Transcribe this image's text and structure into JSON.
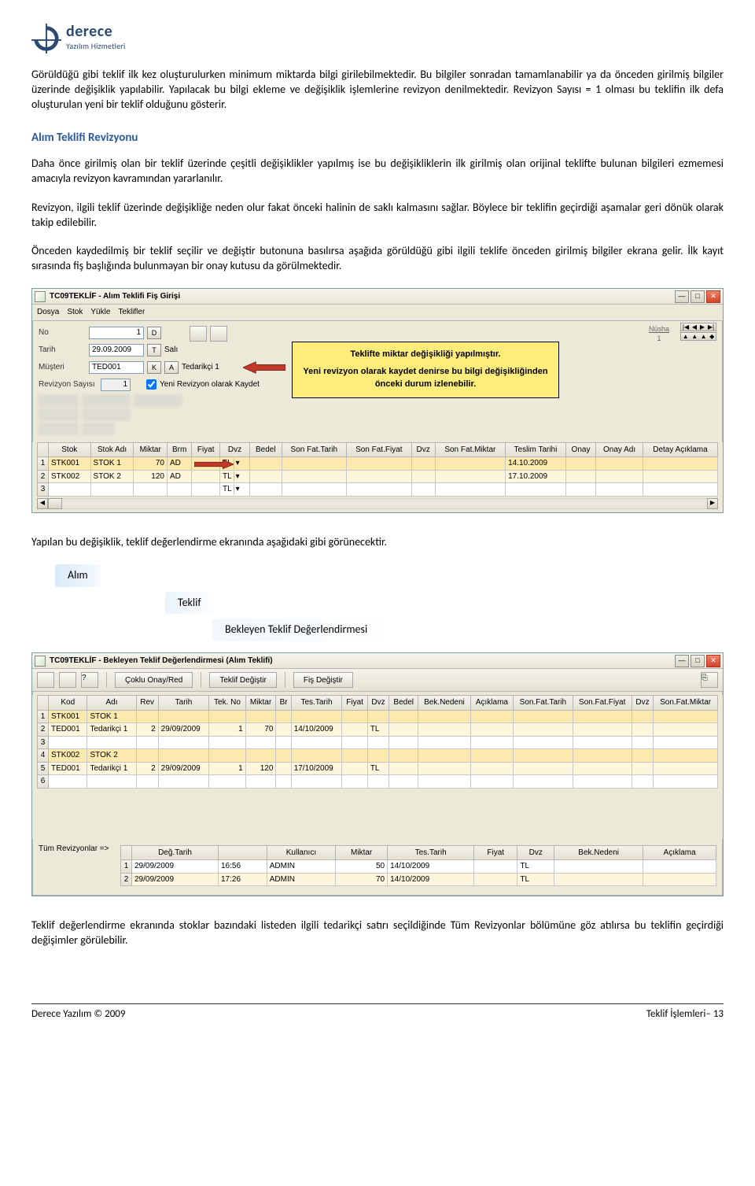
{
  "logo": {
    "name": "derece",
    "sub": "Yazılım Hizmetleri"
  },
  "para1": "Görüldüğü gibi teklif ilk kez oluşturulurken minimum miktarda bilgi girilebilmektedir. Bu bilgiler sonradan tamamlanabilir ya da önceden girilmiş bilgiler üzerinde değişiklik yapılabilir. Yapılacak bu bilgi ekleme ve değişiklik işlemlerine revizyon denilmektedir. Revizyon Sayısı = 1 olması bu teklifin ilk defa oluşturulan yeni bir teklif olduğunu gösterir.",
  "section1_title": "Alım Teklifi Revizyonu",
  "para2": "Daha önce girilmiş olan bir teklif üzerinde çeşitli değişiklikler yapılmış ise bu değişikliklerin ilk girilmiş olan orijinal teklifte bulunan bilgileri ezmemesi amacıyla revizyon kavramından yararlanılır.",
  "para3": "Revizyon, ilgili teklif üzerinde değişikliğe neden olur fakat önceki halinin de saklı kalmasını sağlar. Böylece bir teklifin geçirdiği aşamalar geri dönük olarak takip edilebilir.",
  "para4": "Önceden kaydedilmiş bir teklif seçilir ve değiştir butonuna basılırsa aşağıda görüldüğü gibi ilgili teklife önceden girilmiş bilgiler ekrana gelir. İlk kayıt sırasında fiş başlığında bulunmayan bir onay kutusu da görülmektedir.",
  "win1": {
    "title": "TC09TEKLİF - Alım Teklifi Fiş Girişi",
    "menu": [
      "Dosya",
      "Stok",
      "Yükle",
      "Teklifler"
    ],
    "labels": {
      "no": "No",
      "tarih": "Tarih",
      "musteri": "Müşteri",
      "revsayisi": "Revizyon Sayısı",
      "day": "Salı",
      "checkbox": "Yeni Revizyon olarak Kaydet",
      "nusha": "Nüsha",
      "nusha_val": "1"
    },
    "fields": {
      "no": "1",
      "tarih": "29.09.2009",
      "musteri": "TED001",
      "musteri_ad": "Tedarikçi 1",
      "revsayisi": "1"
    },
    "buttons": {
      "d": "D",
      "t": "T",
      "k": "K",
      "a": "A"
    },
    "callout": {
      "line1": "Teklifte miktar değişikliği yapılmıştır.",
      "line2": "Yeni revizyon olarak kaydet denirse bu bilgi değişikliğinden önceki durum izlenebilir."
    },
    "headers": [
      "",
      "Stok",
      "Stok Adı",
      "Miktar",
      "Brm",
      "Fiyat",
      "Dvz",
      "Bedel",
      "Son Fat.Tarih",
      "Son Fat.Fiyat",
      "Dvz",
      "Son Fat.Miktar",
      "Teslim Tarihi",
      "Onay",
      "Onay Adı",
      "Detay Açıklama"
    ],
    "rows": [
      {
        "n": "1",
        "stok": "STK001",
        "ad": "STOK 1",
        "miktar": "70",
        "brm": "AD",
        "fiy": "",
        "dvz": "TL",
        "bed": "",
        "sft": "",
        "sff": "",
        "dvz2": "",
        "sfm": "",
        "tt": "14.10.2009",
        "onay": "",
        "oad": "",
        "da": ""
      },
      {
        "n": "2",
        "stok": "STK002",
        "ad": "STOK 2",
        "miktar": "120",
        "brm": "AD",
        "fiy": "",
        "dvz": "TL",
        "bed": "",
        "sft": "",
        "sff": "",
        "dvz2": "",
        "sfm": "",
        "tt": "17.10.2009",
        "onay": "",
        "oad": "",
        "da": ""
      },
      {
        "n": "3",
        "stok": "",
        "ad": "",
        "miktar": "",
        "brm": "",
        "fiy": "",
        "dvz": "TL",
        "bed": "",
        "sft": "",
        "sff": "",
        "dvz2": "",
        "sfm": "",
        "tt": "",
        "onay": "",
        "oad": "",
        "da": ""
      }
    ]
  },
  "para5": "Yapılan bu değişiklik, teklif değerlendirme ekranında aşağıdaki gibi görünecektir.",
  "breadcrumb": {
    "l1": "Alım",
    "l2": "Teklif",
    "l3": "Bekleyen Teklif Değerlendirmesi"
  },
  "win2": {
    "title": "TC09TEKLİF - Bekleyen Teklif Değerlendirmesi (Alım Teklifi)",
    "toolbar": {
      "coklu": "Çoklu Onay/Red",
      "teklif": "Teklif Değiştir",
      "fis": "Fiş Değiştir"
    },
    "headers": [
      "",
      "Kod",
      "Adı",
      "Rev",
      "Tarih",
      "Tek. No",
      "Miktar",
      "Br",
      "Tes.Tarih",
      "Fiyat",
      "Dvz",
      "Bedel",
      "Bek.Nedeni",
      "Açıklama",
      "Son.Fat.Tarih",
      "Son.Fat.Fiyat",
      "Dvz",
      "Son.Fat.Miktar"
    ],
    "rows": [
      {
        "n": "1",
        "kod": "STK001",
        "ad": "STOK 1",
        "rev": "",
        "tar": "",
        "tno": "",
        "mik": "",
        "br": "",
        "tes": "",
        "fiy": "",
        "dvz": "",
        "bed": "",
        "bek": "",
        "ac": "",
        "sft": "",
        "sff": "",
        "dvz2": "",
        "sfm": ""
      },
      {
        "n": "2",
        "kod": "TED001",
        "ad": "Tedarikçi 1",
        "rev": "2",
        "tar": "29/09/2009",
        "tno": "1",
        "mik": "70",
        "br": "",
        "tes": "14/10/2009",
        "fiy": "",
        "dvz": "TL",
        "bed": "",
        "bek": "",
        "ac": "",
        "sft": "",
        "sff": "",
        "dvz2": "",
        "sfm": ""
      },
      {
        "n": "3",
        "kod": "",
        "ad": "",
        "rev": "",
        "tar": "",
        "tno": "",
        "mik": "",
        "br": "",
        "tes": "",
        "fiy": "",
        "dvz": "",
        "bed": "",
        "bek": "",
        "ac": "",
        "sft": "",
        "sff": "",
        "dvz2": "",
        "sfm": ""
      },
      {
        "n": "4",
        "kod": "STK002",
        "ad": "STOK 2",
        "rev": "",
        "tar": "",
        "tno": "",
        "mik": "",
        "br": "",
        "tes": "",
        "fiy": "",
        "dvz": "",
        "bed": "",
        "bek": "",
        "ac": "",
        "sft": "",
        "sff": "",
        "dvz2": "",
        "sfm": ""
      },
      {
        "n": "5",
        "kod": "TED001",
        "ad": "Tedarikçi 1",
        "rev": "2",
        "tar": "29/09/2009",
        "tno": "1",
        "mik": "120",
        "br": "",
        "tes": "17/10/2009",
        "fiy": "",
        "dvz": "TL",
        "bed": "",
        "bek": "",
        "ac": "",
        "sft": "",
        "sff": "",
        "dvz2": "",
        "sfm": ""
      },
      {
        "n": "6",
        "kod": "",
        "ad": "",
        "rev": "",
        "tar": "",
        "tno": "",
        "mik": "",
        "br": "",
        "tes": "",
        "fiy": "",
        "dvz": "",
        "bed": "",
        "bek": "",
        "ac": "",
        "sft": "",
        "sff": "",
        "dvz2": "",
        "sfm": ""
      }
    ],
    "rev_label": "Tüm Revizyonlar =>",
    "rev_headers": [
      "",
      "Değ.Tarih",
      "",
      "Kullanıcı",
      "Miktar",
      "Tes.Tarih",
      "Fiyat",
      "Dvz",
      "Bek.Nedeni",
      "Açıklama"
    ],
    "rev_rows": [
      {
        "n": "1",
        "dt": "29/09/2009",
        "tm": "16:56",
        "kul": "ADMIN",
        "mik": "50",
        "tes": "14/10/2009",
        "fiy": "",
        "dvz": "TL",
        "bek": "",
        "ac": ""
      },
      {
        "n": "2",
        "dt": "29/09/2009",
        "tm": "17:26",
        "kul": "ADMIN",
        "mik": "70",
        "tes": "14/10/2009",
        "fiy": "",
        "dvz": "TL",
        "bek": "",
        "ac": ""
      }
    ]
  },
  "para6": "Teklif değerlendirme ekranında stoklar bazındaki listeden ilgili tedarikçi satırı seçildiğinde Tüm Revizyonlar bölümüne göz atılırsa bu teklifin geçirdiği değişimler görülebilir.",
  "footer": {
    "left": "Derece Yazılım © 2009",
    "right": "Teklif İşlemleri– 13"
  }
}
